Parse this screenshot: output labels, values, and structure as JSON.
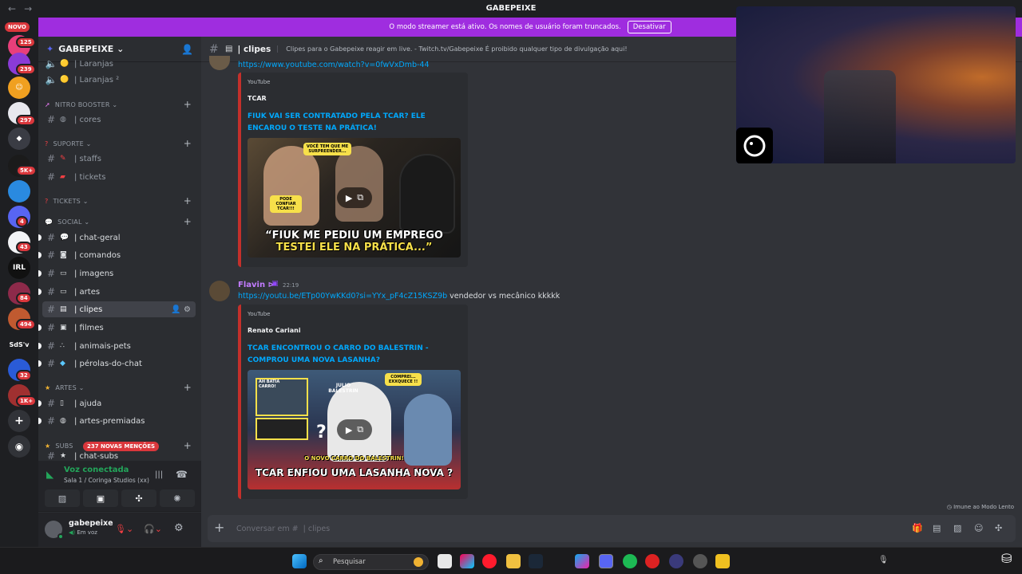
{
  "titlebar": {
    "title": "GABEPEIXE",
    "back": "←",
    "forward": "→"
  },
  "banner": {
    "text": "O modo streamer está ativo. Os nomes de usuário foram truncados.",
    "button": "Desativar"
  },
  "guilds": {
    "novo_label": "NOVO",
    "badges": [
      "125",
      "239",
      "297",
      "5K+",
      "4",
      "43",
      "84",
      "494",
      "32",
      "1K+"
    ],
    "text_guilds": [
      "IRL",
      "SdS'v"
    ]
  },
  "server": {
    "name": "GABEPEIXE ⌄",
    "mention_badge": "237 NOVAS MENÇÕES"
  },
  "channels": {
    "partial_top": "| Laranjas",
    "laranjas2": "| Laranjas ²",
    "cat_nitro": "NITRO BOOSTER ⌄",
    "cores": "| cores",
    "cat_suporte": "SUPORTE ⌄",
    "staffs": "| staffs",
    "tickets": "| tickets",
    "cat_tickets": "TICKETS ⌄",
    "cat_social": "SOCIAL ⌄",
    "chat_geral": "| chat-geral",
    "comandos": "| comandos",
    "imagens": "| imagens",
    "artes": "| artes",
    "clipes": "| clipes",
    "filmes": "| filmes",
    "animais": "| animais-pets",
    "perolas": "| pérolas-do-chat",
    "cat_artes": "ARTES ⌄",
    "ajuda": "| ajuda",
    "artes_premiadas": "| artes-premiadas",
    "cat_subs": "SUBS",
    "partial_bottom": "| chat-subs"
  },
  "voice": {
    "status": "Voz conectada",
    "room": "Sala 1 / Coringa Studios (xx)"
  },
  "user": {
    "name": "gabepeixe",
    "status": "Em voz"
  },
  "channel_header": {
    "name": "| clipes",
    "topic": "Clipes para o Gabepeixe reagir em live. - Twitch.tv/Gabepeixe É proibido qualquer tipo de divulgação aqui!"
  },
  "messages": [
    {
      "link": "https://www.youtube.com/watch?v=0fwVxDmb-44",
      "embed": {
        "provider": "YouTube",
        "author": "TCAR",
        "title": "FIUK VAI SER CONTRATADO PELA TCAR? ELE ENCAROU O TESTE NA PRÁTICA!",
        "thumb_caption_1": "“FIUK ME PEDIU UM EMPREGO",
        "thumb_caption_2": "TESTEI ELE NA PRÁTICA...”",
        "thumb_bubble_1": "VOCÊ TEM QUE ME SURPREENDER...",
        "thumb_bubble_2": "PODE CONFIAR TCAR!!!"
      }
    },
    {
      "author": "Flavin ⊳",
      "time": "22:19",
      "link": "https://youtu.be/ETp00YwKKd0?si=YYx_pF4cZ15KSZ9b",
      "text": " vendedor vs mecânico kkkkk",
      "embed": {
        "provider": "YouTube",
        "author": "Renato Cariani",
        "title": "TCAR ENCONTROU O CARRO DO BALESTRIN - COMPROU UMA NOVA LASANHA?",
        "thumb_caption_1": "O NOVO CARRO DO BALESTRIN!",
        "thumb_caption_2": "TCAR ENFIOU UMA LASANHA NOVA ?",
        "thumb_bubble_1": "COMPREI... EXXQUECE !!",
        "thumb_bubble_2": "JULIO BALESTRIN",
        "thumb_bubble_3": "AH BATIA CARRO!"
      }
    }
  ],
  "composer": {
    "placeholder": "Conversar em #  | clipes"
  },
  "slowmode": "Imune ao Modo Lento",
  "taskbar": {
    "search": "Pesquisar"
  },
  "colors": {
    "accent": "#9f2ddf",
    "link": "#00a8fc",
    "online": "#23a55a",
    "badge": "#da373c",
    "embed_border": "#c4302b"
  }
}
